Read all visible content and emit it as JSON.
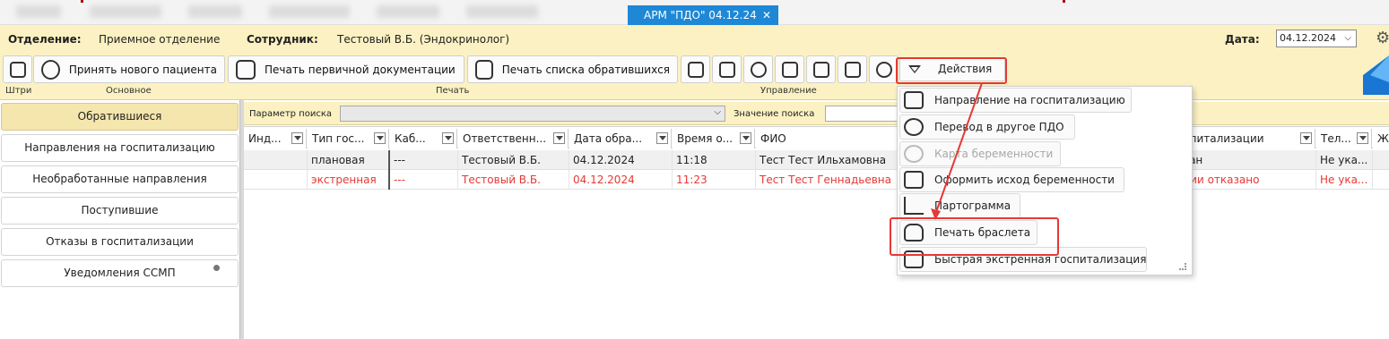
{
  "window": {
    "tab_title": "АРМ \"ПДО\" 04.12.24",
    "tab_close": "✕"
  },
  "info": {
    "department_label": "Отделение:",
    "department_value": "Приемное отделение",
    "employee_label": "Сотрудник:",
    "employee_value": "Тестовый В.Б. (Эндокринолог)",
    "date_label": "Дата:",
    "date_value": "04.12.2024"
  },
  "toolbar": {
    "accept_patient": "Принять нового пациента",
    "print_primary": "Печать первичной документации",
    "print_list": "Печать списка обратившихся",
    "actions": "Действия",
    "groups": {
      "barcode": "Штри",
      "main": "Основное",
      "print": "Печать",
      "management": "Управление"
    }
  },
  "sidebar": {
    "items": [
      "Обратившиеся",
      "Направления на госпитализацию",
      "Необработанные направления",
      "Поступившие",
      "Отказы в госпитализации",
      "Уведомления ССМП"
    ]
  },
  "search": {
    "param_label": "Параметр поиска",
    "value_label": "Значение поиска"
  },
  "table": {
    "headers": [
      "Инд...",
      "Тип гос...",
      "Каб...",
      "Ответственн...",
      "Дата обра...",
      "Время о...",
      "ФИО",
      "спитализации",
      "Тел...",
      "Ж"
    ],
    "rows": [
      {
        "type": "плановая",
        "cab": "---",
        "resp": "Тестовый В.Б.",
        "date": "04.12.2024",
        "time": "11:18",
        "fio": "Тест Тест Ильхамовна",
        "hosp": "ван",
        "tel": "Не ука..."
      },
      {
        "type": "экстренная",
        "cab": "---",
        "resp": "Тестовый В.Б.",
        "date": "04.12.2024",
        "time": "11:23",
        "fio": "Тест Тест Геннадьевна",
        "hosp": "ции отказано",
        "tel": "Не ука..."
      }
    ]
  },
  "menu": {
    "items": [
      {
        "label": "Направление на госпитализацию",
        "icon": "referral-icon",
        "disabled": false
      },
      {
        "label": "Перевод в другое ПДО",
        "icon": "transfer-icon",
        "disabled": false
      },
      {
        "label": "Карта беременности",
        "icon": "pregnancy-card-icon",
        "disabled": true
      },
      {
        "label": "Оформить исход беременности",
        "icon": "archive-icon",
        "disabled": false
      },
      {
        "label": "Партограмма",
        "icon": "chart-line-icon",
        "disabled": false
      },
      {
        "label": "Печать браслета",
        "icon": "hand-icon",
        "disabled": false
      },
      {
        "label": "Быстрая экстренная госпитализация",
        "icon": "ambulance-icon",
        "disabled": false
      }
    ]
  },
  "colors": {
    "ribbon": "#fbf1c2",
    "tab": "#1e88d6",
    "highlight": "#e53935",
    "emergency_text": "#e53935"
  }
}
